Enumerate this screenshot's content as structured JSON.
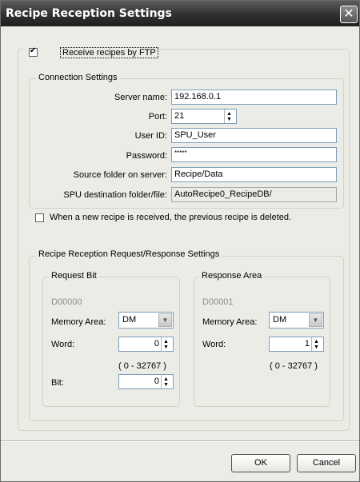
{
  "window": {
    "title": "Recipe Reception Settings"
  },
  "receive_ftp": {
    "label": "Receive recipes by FTP",
    "checked": true
  },
  "connection": {
    "group_label": "Connection Settings",
    "server_name_label": "Server name:",
    "server_name_value": "192.168.0.1",
    "port_label": "Port:",
    "port_value": "21",
    "user_id_label": "User ID:",
    "user_id_value": "SPU_User",
    "password_label": "Password:",
    "password_value": "*****",
    "source_folder_label": "Source folder on server:",
    "source_folder_value": "Recipe/Data",
    "destination_label": "SPU destination folder/file:",
    "destination_value": "AutoRecipe0_RecipeDB/"
  },
  "delete_previous": {
    "label": "When a new recipe is received, the previous recipe is deleted.",
    "checked": false
  },
  "request_response": {
    "group_label": "Recipe Reception Request/Response Settings",
    "request": {
      "group_label": "Request Bit",
      "address": "D00000",
      "memory_area_label": "Memory Area:",
      "memory_area_value": "DM",
      "word_label": "Word:",
      "word_value": "0",
      "range": "( 0 - 32767 )",
      "bit_label": "Bit:",
      "bit_value": "0"
    },
    "response": {
      "group_label": "Response Area",
      "address": "D00001",
      "memory_area_label": "Memory Area:",
      "memory_area_value": "DM",
      "word_label": "Word:",
      "word_value": "1",
      "range": "( 0 - 32767 )"
    }
  },
  "buttons": {
    "ok": "OK",
    "cancel": "Cancel"
  }
}
